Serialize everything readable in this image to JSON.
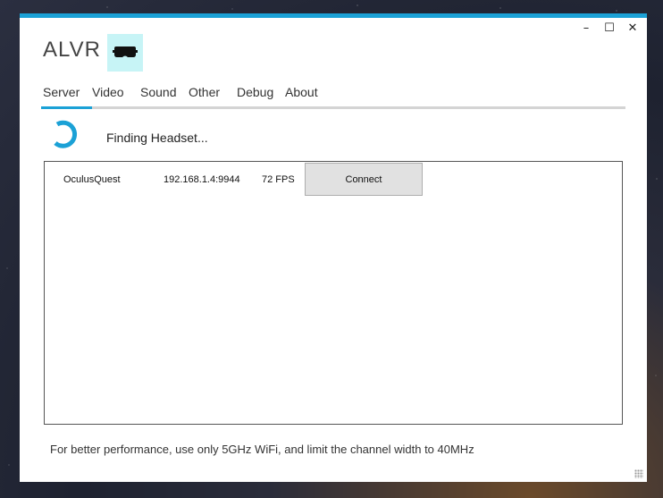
{
  "app": {
    "title": "ALVR",
    "logo_icon": "vr-headset-icon",
    "accent_color": "#1ba1d6"
  },
  "window_controls": {
    "minimize": "–",
    "maximize": "☐",
    "close": "✕"
  },
  "tabs": [
    {
      "label": "Server",
      "active": true
    },
    {
      "label": "Video",
      "active": false
    },
    {
      "label": "Sound",
      "active": false
    },
    {
      "label": "Other",
      "active": false
    },
    {
      "label": "Debug",
      "active": false
    },
    {
      "label": "About",
      "active": false
    }
  ],
  "status": {
    "icon": "loading-spinner-icon",
    "text": "Finding Headset..."
  },
  "devices": [
    {
      "name": "OculusQuest",
      "address": "192.168.1.4:9944",
      "fps": "72 FPS",
      "button_label": "Connect"
    }
  ],
  "footer": {
    "hint": "For better performance, use only 5GHz WiFi, and limit the channel width to 40MHz"
  }
}
